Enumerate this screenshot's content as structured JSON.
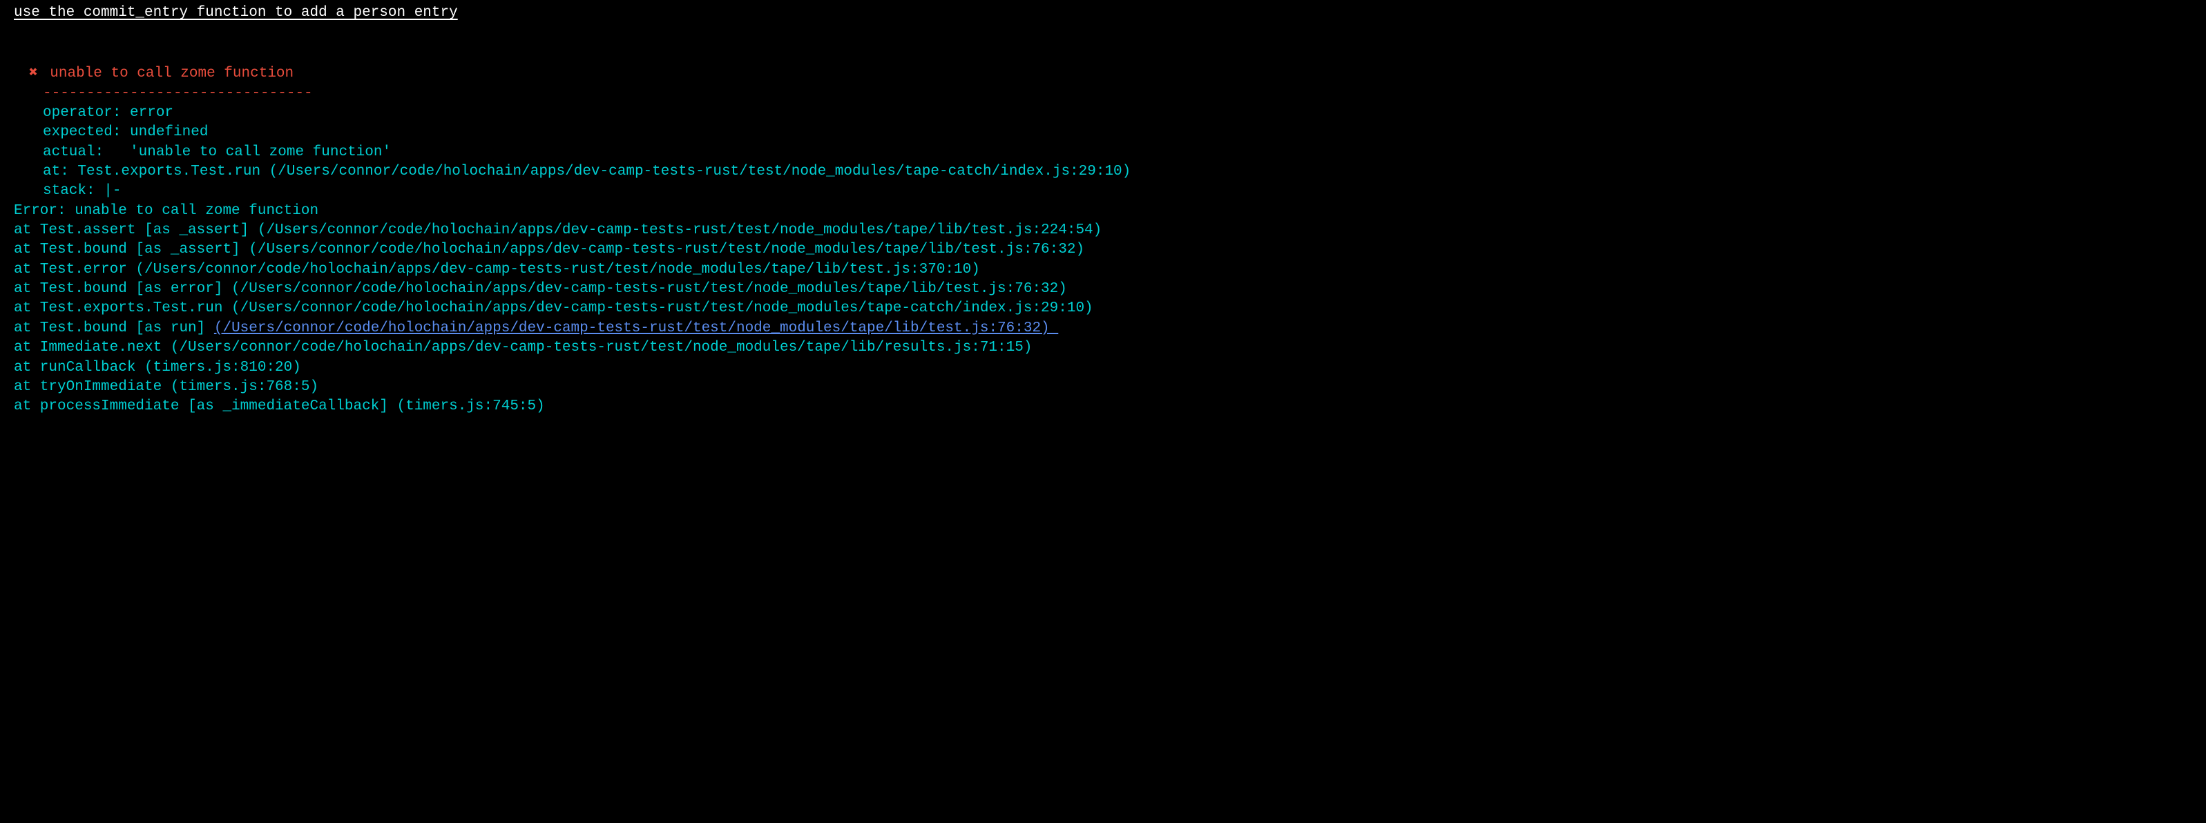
{
  "test": {
    "title": "use the commit_entry function to add a person entry "
  },
  "error": {
    "icon": "✖",
    "message": "unable to call zome function",
    "divider": "-------------------------------",
    "details": {
      "operator": "operator: error",
      "expected": "expected: undefined",
      "actual": "actual:   'unable to call zome function'",
      "at": "at: Test.exports.Test.run (/Users/connor/code/holochain/apps/dev-camp-tests-rust/test/node_modules/tape-catch/index.js:29:10)",
      "stack": "stack: |-"
    },
    "stacklines": {
      "l0": "Error: unable to call zome function",
      "l1": "at Test.assert [as _assert] (/Users/connor/code/holochain/apps/dev-camp-tests-rust/test/node_modules/tape/lib/test.js:224:54)",
      "l2": "at Test.bound [as _assert] (/Users/connor/code/holochain/apps/dev-camp-tests-rust/test/node_modules/tape/lib/test.js:76:32)",
      "l3": "at Test.error (/Users/connor/code/holochain/apps/dev-camp-tests-rust/test/node_modules/tape/lib/test.js:370:10)",
      "l4": "at Test.bound [as error] (/Users/connor/code/holochain/apps/dev-camp-tests-rust/test/node_modules/tape/lib/test.js:76:32)",
      "l5": "at Test.exports.Test.run (/Users/connor/code/holochain/apps/dev-camp-tests-rust/test/node_modules/tape-catch/index.js:29:10)",
      "l6_prefix": "at Test.bound [as run] ",
      "l6_link": "(/Users/connor/code/holochain/apps/dev-camp-tests-rust/test/node_modules/tape/lib/test.js:76:32) ",
      "l7": "at Immediate.next (/Users/connor/code/holochain/apps/dev-camp-tests-rust/test/node_modules/tape/lib/results.js:71:15)",
      "l8": "at runCallback (timers.js:810:20)",
      "l9": "at tryOnImmediate (timers.js:768:5)",
      "l10": "at processImmediate [as _immediateCallback] (timers.js:745:5)"
    }
  }
}
